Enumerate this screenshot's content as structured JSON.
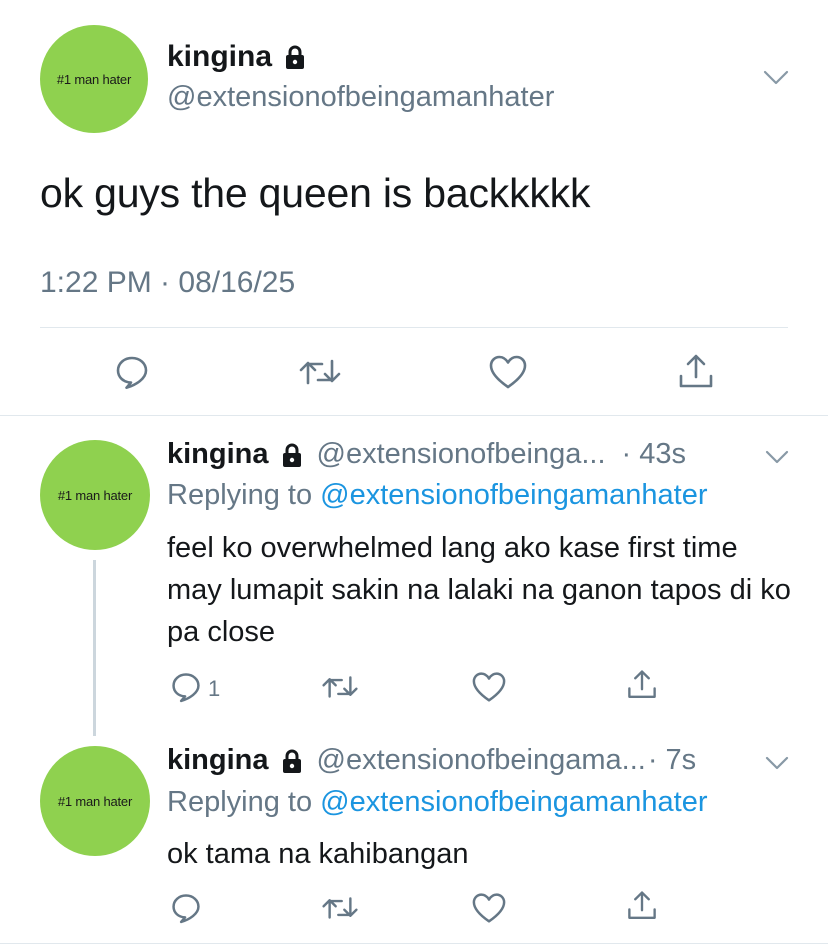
{
  "main_tweet": {
    "avatar_text": "#1 man hater",
    "display_name": "kingina",
    "handle": "@extensionofbeingamanhater",
    "text": "ok guys the queen is backkkkk",
    "timestamp": "1:22 PM · 08/16/25"
  },
  "replies": [
    {
      "avatar_text": "#1 man hater",
      "display_name": "kingina",
      "handle": "@extensionofbeinga...",
      "time": "· 43s",
      "replying_prefix": "Replying to ",
      "replying_to": "@extensionofbeingamanhater",
      "text": "feel ko overwhelmed lang ako kase first time may lumapit sakin na lalaki na ganon tapos di ko pa close",
      "reply_count": "1"
    },
    {
      "avatar_text": "#1 man hater",
      "display_name": "kingina",
      "handle": "@extensionofbeingama...",
      "time": "· 7s",
      "replying_prefix": "Replying to ",
      "replying_to": "@extensionofbeingamanhater",
      "text": "ok tama na kahibangan"
    }
  ],
  "colors": {
    "avatar": "#8fd14f",
    "link": "#1b95e0",
    "secondary_text": "#657786",
    "icon": "#657786"
  },
  "icons": [
    "lock-icon",
    "chevron-down-icon",
    "reply-icon",
    "retweet-icon",
    "like-icon",
    "share-icon"
  ]
}
